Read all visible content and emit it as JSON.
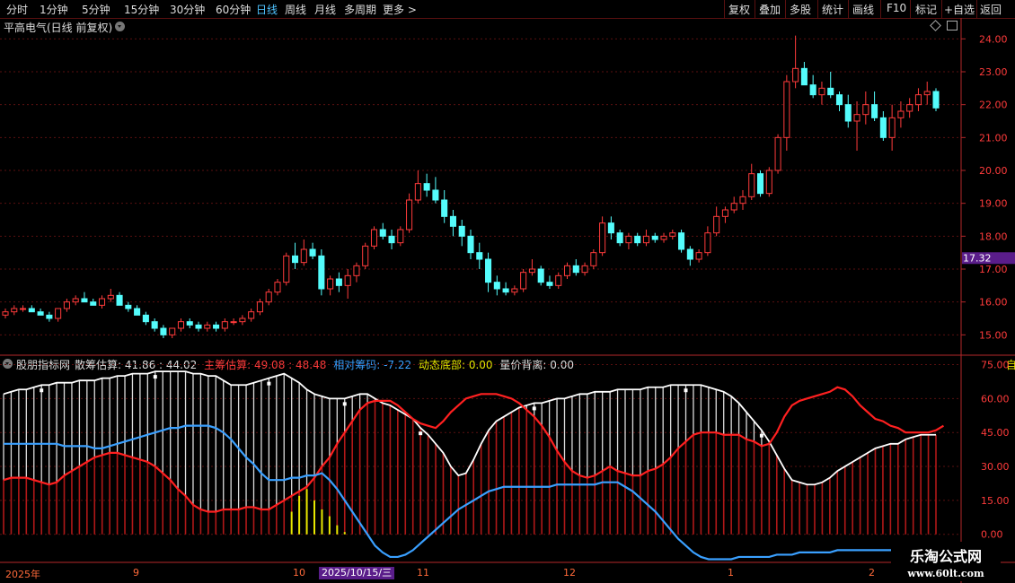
{
  "toolbar": {
    "periods": [
      "分时",
      "1分钟",
      "5分钟",
      "15分钟",
      "30分钟",
      "60分钟",
      "日线",
      "周线",
      "月线",
      "多周期",
      "更多"
    ],
    "more_arrow": ">",
    "active": "日线",
    "right_buttons": [
      "复权",
      "叠加",
      "多股",
      "统计",
      "画线",
      "F10",
      "标记",
      "+自选",
      "返回"
    ]
  },
  "main_panel": {
    "title": "平高电气(日线 前复权)",
    "price_ticks": [
      "24.00",
      "23.00",
      "22.00",
      "21.00",
      "20.00",
      "19.00",
      "18.00",
      "17.00",
      "16.00",
      "15.00"
    ],
    "current_price_tag": "17.32"
  },
  "indicator_panel": {
    "name": "股朋指标网",
    "items": [
      {
        "label": "散筹估算:",
        "value": "41.86 : 44.02",
        "color": "#dddddd"
      },
      {
        "label": "主筹估算:",
        "value": "49.08 : 48.48",
        "color": "#ff3b3b"
      },
      {
        "label": "相对筹码:",
        "value": "-7.22",
        "color": "#3aa0ff"
      },
      {
        "label": "动态底部:",
        "value": "0.00",
        "color": "#e8e800"
      },
      {
        "label": "量价背离:",
        "value": "0.00",
        "color": "#dddddd"
      }
    ],
    "ticks": [
      "75.00",
      "60.00",
      "45.00",
      "30.00",
      "15.00",
      "0.00"
    ],
    "top_right_char": "自"
  },
  "date_axis": {
    "labels": [
      "2025年",
      "9",
      "10",
      "11",
      "12",
      "1",
      "2"
    ],
    "selected_date": "2025/10/15/三"
  },
  "watermark": {
    "line1": "乐淘公式网",
    "line2": "www.60lt.com"
  },
  "colors": {
    "up": "#ff3b3b",
    "down": "#54fcfc",
    "grid": "#5a1010",
    "axis": "#b4282a",
    "white_line": "#ffffff",
    "blue_line": "#3aa0ff",
    "red_line": "#ff2020"
  },
  "chart_data": [
    {
      "type": "candlestick",
      "title": "平高电气(日线 前复权)",
      "ylim": [
        14.6,
        24.2
      ],
      "ohlc": [
        [
          15.6,
          15.8,
          15.5,
          15.7
        ],
        [
          15.7,
          15.9,
          15.6,
          15.8
        ],
        [
          15.8,
          15.9,
          15.7,
          15.8
        ],
        [
          15.8,
          15.9,
          15.7,
          15.7
        ],
        [
          15.7,
          15.8,
          15.6,
          15.6
        ],
        [
          15.6,
          15.7,
          15.4,
          15.5
        ],
        [
          15.5,
          15.8,
          15.4,
          15.8
        ],
        [
          15.8,
          16.1,
          15.7,
          16.0
        ],
        [
          16.0,
          16.2,
          15.9,
          16.1
        ],
        [
          16.1,
          16.3,
          16.0,
          16.0
        ],
        [
          16.0,
          16.1,
          15.9,
          15.9
        ],
        [
          15.9,
          16.2,
          15.8,
          16.1
        ],
        [
          16.1,
          16.4,
          16.0,
          16.2
        ],
        [
          16.2,
          16.3,
          15.9,
          15.9
        ],
        [
          15.9,
          16.0,
          15.7,
          15.8
        ],
        [
          15.8,
          15.9,
          15.6,
          15.6
        ],
        [
          15.6,
          15.7,
          15.3,
          15.4
        ],
        [
          15.4,
          15.5,
          15.1,
          15.2
        ],
        [
          15.2,
          15.3,
          14.9,
          15.0
        ],
        [
          15.0,
          15.2,
          14.9,
          15.2
        ],
        [
          15.2,
          15.5,
          15.1,
          15.4
        ],
        [
          15.4,
          15.5,
          15.2,
          15.3
        ],
        [
          15.3,
          15.4,
          15.1,
          15.2
        ],
        [
          15.2,
          15.4,
          15.1,
          15.3
        ],
        [
          15.3,
          15.4,
          15.1,
          15.2
        ],
        [
          15.2,
          15.5,
          15.1,
          15.4
        ],
        [
          15.4,
          15.5,
          15.3,
          15.4
        ],
        [
          15.4,
          15.6,
          15.3,
          15.5
        ],
        [
          15.5,
          15.8,
          15.4,
          15.7
        ],
        [
          15.7,
          16.1,
          15.6,
          16.0
        ],
        [
          16.0,
          16.4,
          15.9,
          16.3
        ],
        [
          16.3,
          16.7,
          16.2,
          16.6
        ],
        [
          16.6,
          17.5,
          16.5,
          17.4
        ],
        [
          17.4,
          17.8,
          17.0,
          17.2
        ],
        [
          17.2,
          17.9,
          17.1,
          17.6
        ],
        [
          17.6,
          17.8,
          17.3,
          17.4
        ],
        [
          17.4,
          17.6,
          16.2,
          16.4
        ],
        [
          16.4,
          16.8,
          16.2,
          16.7
        ],
        [
          16.7,
          16.9,
          16.3,
          16.5
        ],
        [
          16.5,
          17.0,
          16.1,
          16.8
        ],
        [
          16.8,
          17.2,
          16.6,
          17.1
        ],
        [
          17.1,
          17.8,
          17.0,
          17.7
        ],
        [
          17.7,
          18.3,
          17.6,
          18.2
        ],
        [
          18.2,
          18.4,
          17.9,
          18.0
        ],
        [
          18.0,
          18.2,
          17.6,
          17.8
        ],
        [
          17.8,
          18.3,
          17.7,
          18.2
        ],
        [
          18.2,
          19.3,
          18.1,
          19.1
        ],
        [
          19.1,
          20.0,
          19.0,
          19.6
        ],
        [
          19.6,
          19.9,
          19.2,
          19.4
        ],
        [
          19.4,
          19.8,
          19.0,
          19.1
        ],
        [
          19.1,
          19.4,
          18.4,
          18.6
        ],
        [
          18.6,
          18.8,
          18.0,
          18.3
        ],
        [
          18.3,
          18.5,
          17.7,
          18.0
        ],
        [
          18.0,
          18.2,
          17.3,
          17.5
        ],
        [
          17.5,
          17.8,
          17.0,
          17.3
        ],
        [
          17.3,
          17.5,
          16.3,
          16.6
        ],
        [
          16.6,
          16.8,
          16.2,
          16.4
        ],
        [
          16.4,
          16.6,
          16.2,
          16.3
        ],
        [
          16.3,
          16.5,
          16.2,
          16.4
        ],
        [
          16.4,
          17.0,
          16.3,
          16.9
        ],
        [
          16.9,
          17.3,
          16.8,
          17.0
        ],
        [
          17.0,
          17.1,
          16.5,
          16.6
        ],
        [
          16.6,
          16.8,
          16.4,
          16.5
        ],
        [
          16.5,
          16.9,
          16.4,
          16.8
        ],
        [
          16.8,
          17.2,
          16.7,
          17.1
        ],
        [
          17.1,
          17.3,
          16.8,
          16.9
        ],
        [
          16.9,
          17.2,
          16.8,
          17.1
        ],
        [
          17.1,
          17.6,
          17.0,
          17.5
        ],
        [
          17.5,
          18.6,
          17.4,
          18.4
        ],
        [
          18.4,
          18.6,
          17.9,
          18.1
        ],
        [
          18.1,
          18.2,
          17.7,
          17.8
        ],
        [
          17.8,
          18.1,
          17.6,
          18.0
        ],
        [
          18.0,
          18.1,
          17.7,
          17.8
        ],
        [
          17.8,
          18.2,
          17.7,
          18.0
        ],
        [
          18.0,
          18.1,
          17.8,
          17.9
        ],
        [
          17.9,
          18.1,
          17.8,
          18.0
        ],
        [
          18.0,
          18.2,
          17.9,
          18.1
        ],
        [
          18.1,
          18.2,
          17.5,
          17.6
        ],
        [
          17.6,
          17.7,
          17.1,
          17.3
        ],
        [
          17.3,
          17.6,
          17.2,
          17.5
        ],
        [
          17.5,
          18.3,
          17.4,
          18.1
        ],
        [
          18.1,
          18.9,
          18.0,
          18.6
        ],
        [
          18.6,
          18.9,
          18.4,
          18.8
        ],
        [
          18.8,
          19.2,
          18.7,
          19.0
        ],
        [
          19.0,
          19.4,
          18.8,
          19.2
        ],
        [
          19.2,
          20.2,
          19.1,
          19.9
        ],
        [
          19.9,
          20.0,
          19.2,
          19.3
        ],
        [
          19.3,
          20.1,
          19.2,
          20.0
        ],
        [
          20.0,
          21.1,
          19.9,
          21.0
        ],
        [
          21.0,
          22.9,
          20.6,
          22.7
        ],
        [
          22.7,
          24.1,
          22.5,
          23.1
        ],
        [
          23.1,
          23.3,
          22.6,
          22.6
        ],
        [
          22.6,
          22.9,
          22.2,
          22.3
        ],
        [
          22.3,
          22.7,
          22.0,
          22.5
        ],
        [
          22.5,
          23.0,
          22.2,
          22.3
        ],
        [
          22.3,
          22.4,
          21.8,
          22.0
        ],
        [
          22.0,
          22.3,
          21.3,
          21.5
        ],
        [
          21.5,
          22.1,
          20.6,
          21.7
        ],
        [
          21.7,
          22.4,
          21.4,
          22.0
        ],
        [
          22.0,
          22.4,
          21.5,
          21.6
        ],
        [
          21.6,
          21.8,
          20.9,
          21.0
        ],
        [
          21.0,
          22.0,
          20.6,
          21.6
        ],
        [
          21.6,
          22.1,
          21.3,
          21.8
        ],
        [
          21.8,
          22.2,
          21.6,
          22.0
        ],
        [
          22.0,
          22.5,
          21.8,
          22.3
        ],
        [
          22.3,
          22.7,
          22.0,
          22.4
        ],
        [
          22.4,
          22.5,
          21.8,
          21.9
        ]
      ]
    },
    {
      "type": "line",
      "title": "股朋指标网",
      "ylim": [
        -12,
        76
      ],
      "series": [
        {
          "name": "散筹估算",
          "values": [
            62,
            63,
            64,
            64,
            65,
            66,
            66,
            67,
            67,
            67,
            68,
            68,
            68,
            69,
            69,
            70,
            70,
            71,
            71,
            71,
            72,
            72,
            72,
            72,
            72,
            71,
            71,
            70,
            70,
            68,
            66,
            66,
            66,
            67,
            68,
            69,
            70,
            71,
            69,
            67,
            64,
            62,
            61,
            60,
            60,
            60,
            61,
            62,
            62,
            60,
            58,
            57,
            55,
            53,
            51,
            47,
            44,
            40,
            36,
            30,
            26,
            27,
            33,
            40,
            46,
            50,
            52,
            54,
            56,
            57,
            58,
            58,
            59,
            60,
            60,
            61,
            62,
            62,
            63,
            63,
            63,
            64,
            64,
            64,
            64,
            65,
            65,
            65,
            66,
            66,
            66,
            66,
            66,
            65,
            64,
            63,
            61,
            58,
            54,
            50,
            46,
            41,
            35,
            29,
            24,
            23,
            22,
            22,
            23,
            25,
            28,
            30,
            32,
            34,
            36,
            38,
            39,
            40,
            40,
            42,
            43,
            44,
            44,
            44
          ]
        },
        {
          "name": "主筹估算",
          "values": [
            24,
            25,
            25,
            25,
            24,
            23,
            22,
            23,
            26,
            28,
            30,
            32,
            34,
            35,
            36,
            36,
            35,
            34,
            33,
            32,
            30,
            27,
            24,
            20,
            17,
            13,
            11,
            10,
            10,
            11,
            11,
            11,
            12,
            12,
            11,
            11,
            13,
            15,
            17,
            19,
            21,
            25,
            30,
            34,
            40,
            45,
            50,
            55,
            58,
            59,
            59,
            59,
            57,
            54,
            51,
            49,
            48,
            47,
            50,
            54,
            57,
            60,
            61,
            62,
            62,
            62,
            61,
            60,
            58,
            55,
            52,
            48,
            43,
            37,
            32,
            28,
            26,
            25,
            26,
            28,
            30,
            28,
            27,
            26,
            26,
            28,
            29,
            31,
            34,
            38,
            41,
            44,
            45,
            45,
            45,
            44,
            44,
            44,
            42,
            41,
            39,
            40,
            45,
            52,
            57,
            59,
            60,
            61,
            62,
            63,
            65,
            64,
            61,
            57,
            54,
            51,
            50,
            48,
            47,
            45,
            45,
            45,
            45,
            46,
            48
          ]
        },
        {
          "name": "相对筹码",
          "values": [
            40,
            40,
            40,
            40,
            40,
            40,
            40,
            40,
            39,
            39,
            39,
            39,
            38,
            38,
            39,
            40,
            41,
            42,
            43,
            44,
            45,
            46,
            47,
            47,
            48,
            48,
            48,
            48,
            47,
            45,
            42,
            38,
            34,
            31,
            27,
            24,
            24,
            24,
            25,
            25,
            26,
            26,
            27,
            24,
            20,
            15,
            10,
            5,
            0,
            -5,
            -8,
            -10,
            -10,
            -9,
            -7,
            -4,
            -1,
            2,
            5,
            8,
            11,
            13,
            15,
            17,
            19,
            20,
            21,
            21,
            21,
            21,
            21,
            21,
            21,
            22,
            22,
            22,
            22,
            22,
            22,
            23,
            23,
            23,
            21,
            19,
            16,
            13,
            10,
            6,
            2,
            -2,
            -5,
            -8,
            -10,
            -11,
            -11,
            -11,
            -11,
            -10,
            -10,
            -10,
            -10,
            -10,
            -9,
            -9,
            -9,
            -8,
            -8,
            -8,
            -8,
            -8,
            -7,
            -7,
            -7,
            -7,
            -7,
            -7,
            -7,
            -7,
            -7,
            -7,
            -7
          ]
        },
        {
          "name": "动态底部",
          "values": [
            0,
            0,
            0,
            0,
            0,
            0,
            0,
            0,
            0,
            0,
            0,
            0,
            0,
            0,
            0,
            0,
            0,
            0,
            0,
            0,
            0,
            0,
            0,
            0,
            0,
            0,
            0,
            0,
            0,
            0,
            0,
            0,
            0,
            0,
            0,
            0,
            0,
            0,
            10,
            17,
            20,
            15,
            11,
            8,
            4,
            1,
            0,
            0,
            0,
            0
          ]
        }
      ]
    }
  ]
}
